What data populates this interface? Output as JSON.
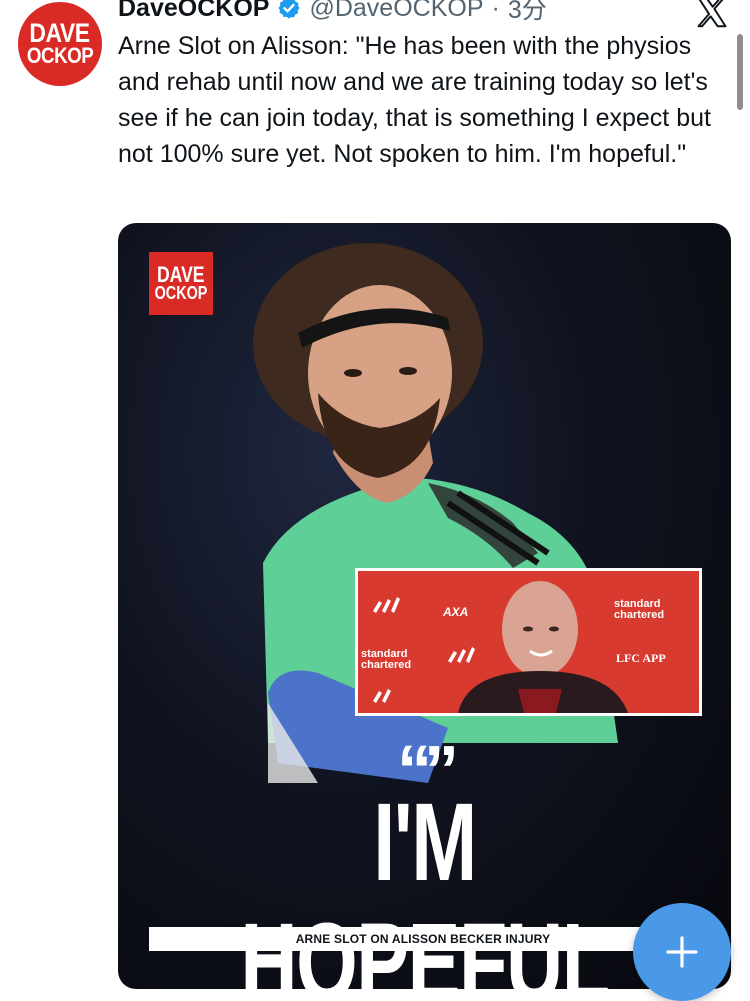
{
  "avatar": {
    "line1": "DAVE",
    "line2": "OCKOP",
    "color": "#d92a25"
  },
  "header": {
    "display_name": "DaveOCKOP",
    "verified_icon": "verified-badge-icon",
    "handle": "@DaveOCKOP",
    "separator": "·",
    "time": "3分",
    "platform_icon": "x-logo-icon"
  },
  "tweet": {
    "text": "Arne Slot on Alisson: \"He has been with the physios and rehab until now and we are training today so let's see if he can join today, that is something I expect but not 100% sure yet. Not spoken to him. I'm hopeful.\""
  },
  "media": {
    "logo_line1": "DAVE",
    "logo_line2": "OCKOP",
    "quote_mark": "“”",
    "headline": "I'M HOPEFUL",
    "caption": "ARNE SLOT ON ALISSON BECKER INJURY",
    "inset_brands": {
      "sponsor1": "standard chartered",
      "sponsor2": "standard chartered",
      "app": "LFC APP"
    }
  },
  "fab": {
    "icon": "plus-icon",
    "color": "#4a99e9"
  },
  "colors": {
    "accent": "#4a99e9",
    "brand_red": "#d92a25",
    "muted": "#536471"
  }
}
